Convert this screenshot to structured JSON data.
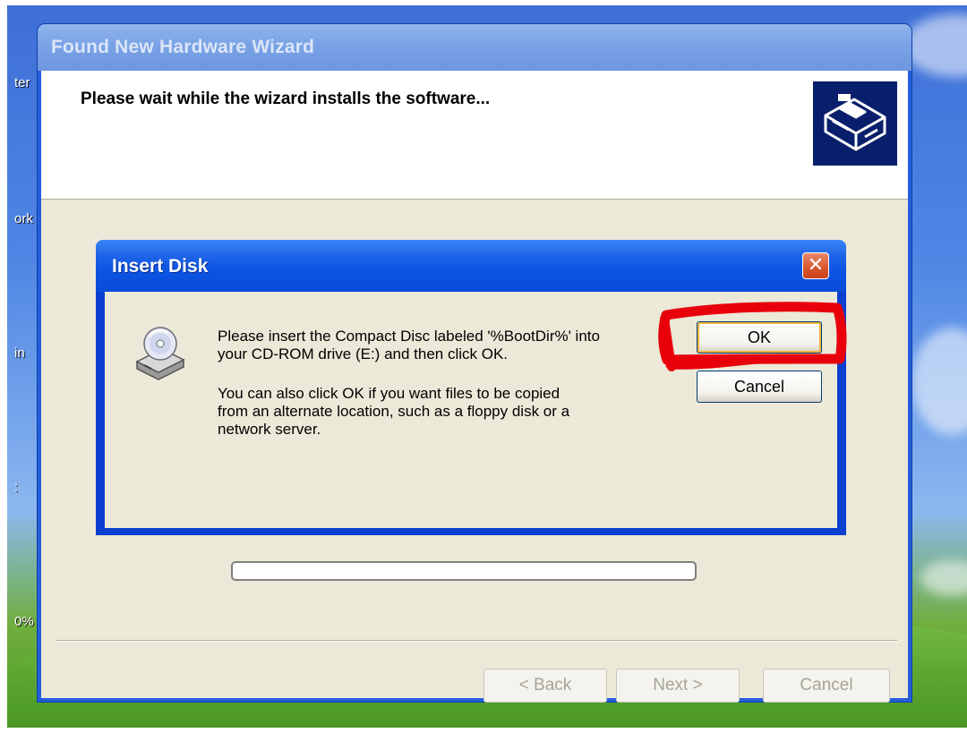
{
  "desktop": {
    "icon_labels": [
      "ter",
      "ork",
      "in",
      ":",
      "0%"
    ]
  },
  "wizard": {
    "title": "Found New Hardware Wizard",
    "heading": "Please wait while the wizard installs the software...",
    "buttons": {
      "back": "< Back",
      "next": "Next >",
      "cancel": "Cancel"
    }
  },
  "dialog": {
    "title": "Insert Disk",
    "close_glyph": "✕",
    "message_line1": "Please insert the Compact Disc labeled '%BootDir%' into",
    "message_line2": "your CD-ROM drive (E:) and then click OK.",
    "message2_line1": "You can also click OK if you want files to be copied",
    "message2_line2": "from an alternate location, such as a floppy disk or a",
    "message2_line3": "network server.",
    "ok_label": "OK",
    "cancel_label": "Cancel"
  },
  "annotation": {
    "color": "#e8000b",
    "target": "ok-button"
  },
  "icons": {
    "dialog_icon": "cd-drive-icon",
    "wizard_icon": "hardware-icon"
  },
  "colors": {
    "xp_blue": "#0a4bd8",
    "dialog_bg": "#ece9d8",
    "close_red": "#d9542b"
  }
}
